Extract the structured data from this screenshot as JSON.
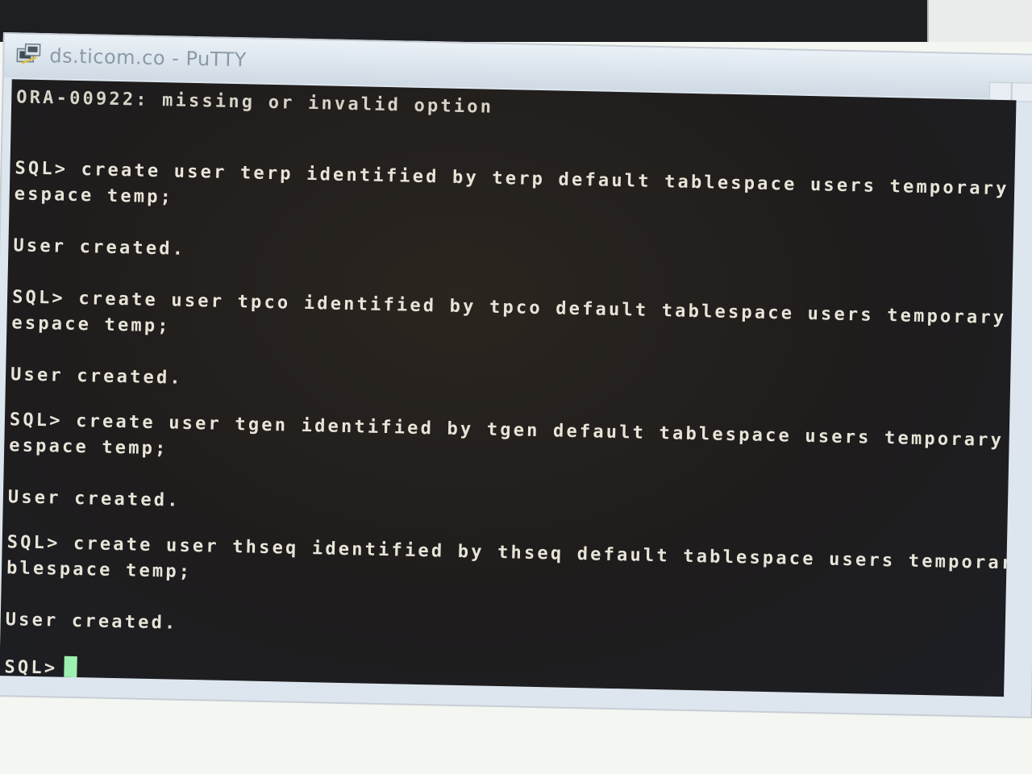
{
  "window": {
    "title": "ds.ticom.co - PuTTY",
    "icon": "putty-icon"
  },
  "terminal": {
    "lines": [
      "ORA-00922: missing or invalid option",
      "",
      "",
      "SQL> create user terp identified by terp default tablespace users temporary tab",
      "espace temp;",
      "",
      "User created.",
      "",
      "SQL> create user tpco identified by tpco default tablespace users temporary tabl",
      "espace temp;",
      "",
      "User created.",
      "",
      "SQL> create user tgen identified by tgen default tablespace users temporary tabl",
      "espace temp;",
      "",
      "User created.",
      "",
      "SQL> create user thseq identified by thseq default tablespace users temporary ta",
      "blespace temp;",
      "",
      "User created.",
      "",
      "SQL>"
    ]
  },
  "colors": {
    "terminal_bg": "#1e1c1c",
    "terminal_text": "#e8e4d8",
    "cursor": "#9ef0b0"
  }
}
